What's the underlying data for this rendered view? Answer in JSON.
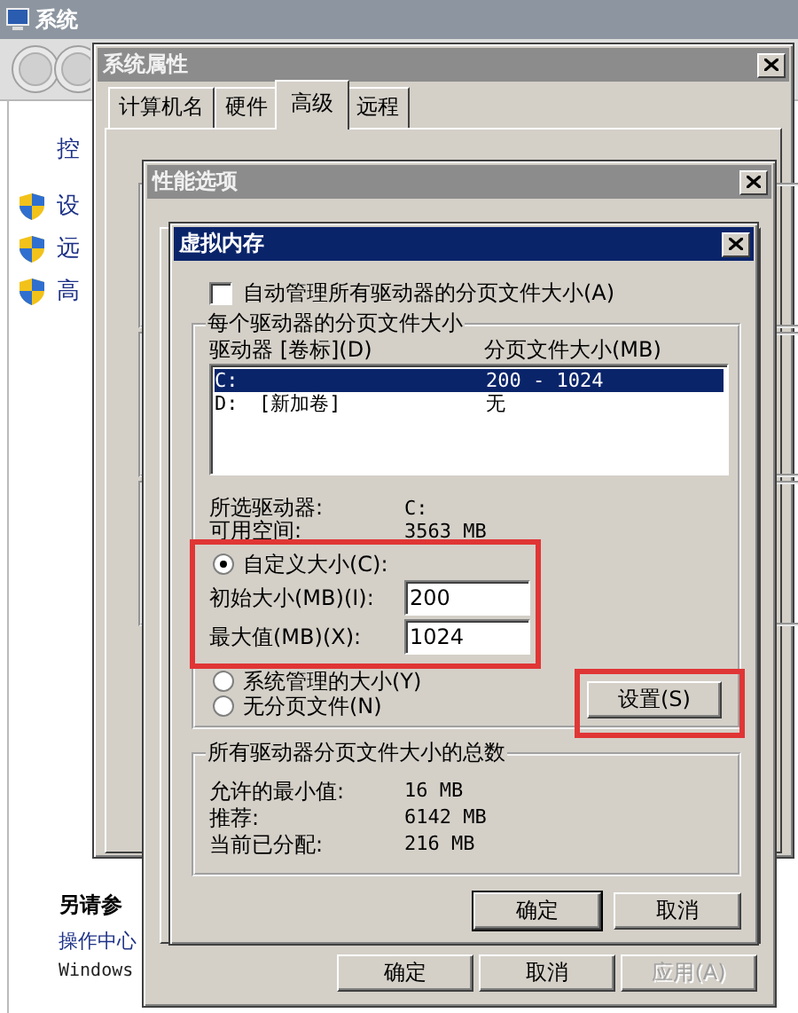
{
  "system_window": {
    "title": "系统",
    "active": false,
    "sidebar": {
      "items": [
        {
          "label": "控",
          "kind": "text"
        },
        {
          "label": "设",
          "kind": "shield"
        },
        {
          "label": "远",
          "kind": "shield"
        },
        {
          "label": "高",
          "kind": "shield"
        }
      ]
    },
    "see_also": {
      "heading": "另请参",
      "links": [
        "操作中心",
        "Windows"
      ]
    }
  },
  "system_properties": {
    "title": "系统属性",
    "active": false,
    "tabs": [
      {
        "label": "计算机名",
        "selected": false
      },
      {
        "label": "硬件",
        "selected": false
      },
      {
        "label": "高级",
        "selected": true
      },
      {
        "label": "远程",
        "selected": false
      }
    ]
  },
  "performance_options": {
    "title": "性能选项",
    "active": false,
    "buttons": [
      {
        "label": "确定",
        "disabled": false
      },
      {
        "label": "取消",
        "disabled": false
      },
      {
        "label": "应用(A)",
        "disabled": true
      }
    ]
  },
  "virtual_memory": {
    "title": "虚拟内存",
    "active": true,
    "auto_manage": {
      "label": "自动管理所有驱动器的分页文件大小(A)",
      "checked": false
    },
    "per_drive": {
      "title": "每个驱动器的分页文件大小",
      "columns": [
        "驱动器 [卷标](D)",
        "分页文件大小(MB)"
      ],
      "rows": [
        {
          "drive": "C:",
          "size": "200 - 1024",
          "selected": true
        },
        {
          "drive": "D:",
          "volume": "[新加卷]",
          "size": "无",
          "selected": false
        }
      ],
      "info": [
        {
          "label": "所选驱动器:",
          "value": "C:"
        },
        {
          "label": "可用空间:",
          "value": "3563 MB"
        }
      ],
      "radios": [
        {
          "label": "自定义大小(C):",
          "selected": true
        },
        {
          "label": "系统管理的大小(Y)",
          "selected": false
        },
        {
          "label": "无分页文件(N)",
          "selected": false
        }
      ],
      "fields": [
        {
          "label": "初始大小(MB)(I):",
          "value": "200"
        },
        {
          "label": "最大值(MB)(X):",
          "value": "1024"
        }
      ],
      "set_button": "设置(S)"
    },
    "totals": {
      "title": "所有驱动器分页文件大小的总数",
      "rows": [
        {
          "label": "允许的最小值:",
          "value": "16 MB"
        },
        {
          "label": "推荐:",
          "value": "6142 MB"
        },
        {
          "label": "当前已分配:",
          "value": "216 MB"
        }
      ]
    },
    "buttons": [
      {
        "label": "确定",
        "default": true
      },
      {
        "label": "取消",
        "default": false
      }
    ]
  }
}
